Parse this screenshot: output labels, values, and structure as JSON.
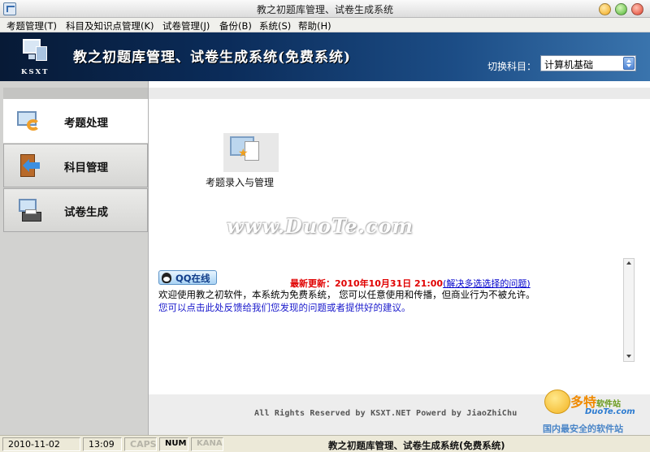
{
  "window": {
    "title": "教之初题库管理、试卷生成系统",
    "min_color": "#f2a81b",
    "max_color": "#4fb534",
    "close_color": "#e0402a"
  },
  "menu": {
    "items": [
      "考题管理(T)",
      "科目及知识点管理(K)",
      "试卷管理(J)",
      "备份(B)",
      "系统(S)",
      "帮助(H)"
    ]
  },
  "banner": {
    "logo_text": "KSXT",
    "title": "教之初题库管理、试卷生成系统(免费系统)",
    "switch_label": "切换科目：",
    "subject_selected": "计算机基础"
  },
  "nav": {
    "items": [
      {
        "label": "考题处理",
        "icon": "question-process-icon",
        "active": true
      },
      {
        "label": "科目管理",
        "icon": "subject-door-icon",
        "active": false
      },
      {
        "label": "试卷生成",
        "icon": "paper-print-icon",
        "active": false
      }
    ]
  },
  "main": {
    "function_tile": {
      "label": "考题录入与管理",
      "icon": "question-entry-icon"
    },
    "watermark": "www.DuoTe.com",
    "qq_button": "QQ在线",
    "news_label": "最新更新：2010年10月31日  21:00",
    "news_link": "(解决多选选择的问题)",
    "welcome": "欢迎使用教之初软件，本系统为免费系统，  您可以任意使用和传播，但商业行为不被允许。",
    "feedback": "您可以点击此处反馈给我们您发现的问题或者提供好的建议。",
    "copyright": "All Rights Reserved by KSXT.NET Powerd by JiaoZhiChu"
  },
  "statusbar": {
    "date": "2010-11-02",
    "time": "13:09",
    "caps": "CAPS",
    "num": "NUM",
    "kana": "KANA",
    "title": "教之初题库管理、试卷生成系统(免费系统)"
  },
  "site_logo": {
    "main": "多特",
    "small": "软件站",
    "url": "DuoTe.com",
    "slogan": "国内最安全的软件站"
  },
  "colors": {
    "banner_dark": "#071a36",
    "banner_light": "#3a74ad",
    "news_red": "#e00000",
    "link_blue": "#0000cc"
  }
}
